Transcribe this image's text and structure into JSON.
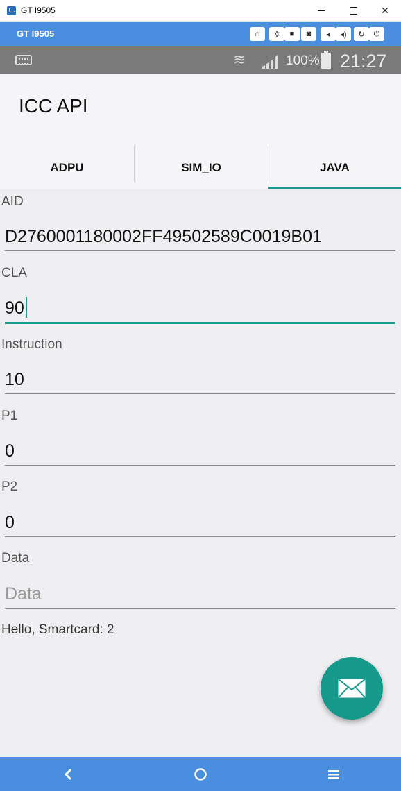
{
  "window": {
    "title": "GT I9505",
    "close_glyph": "✕"
  },
  "emulator": {
    "device_label": "GT I9505",
    "buttons": [
      {
        "icon": "headphones-icon",
        "glyph": "∩"
      },
      {
        "icon": "gear-icon",
        "glyph": "✲"
      },
      {
        "icon": "video-icon",
        "glyph": "■"
      },
      {
        "icon": "camera-icon",
        "glyph": "◙"
      },
      {
        "icon": "volume-down-icon",
        "glyph": "◂"
      },
      {
        "icon": "volume-up-icon",
        "glyph": "◂)"
      },
      {
        "icon": "rotate-icon",
        "glyph": "↻"
      },
      {
        "icon": "power-icon",
        "glyph": "⏻"
      }
    ]
  },
  "status": {
    "battery": "100%",
    "time": "21:27",
    "wifi_glyph": "≋"
  },
  "app": {
    "title": "ICC API"
  },
  "tabs": [
    {
      "label": "ADPU",
      "selected": false
    },
    {
      "label": "SIM_IO",
      "selected": false
    },
    {
      "label": "JAVA",
      "selected": true
    }
  ],
  "accent_color": "#1a9a8a",
  "fields": {
    "aid": {
      "label": "AID",
      "value": "D2760001180002FF49502589C0019B01"
    },
    "cla": {
      "label": "CLA",
      "value": "90"
    },
    "instruction": {
      "label": "Instruction",
      "value": "10"
    },
    "p1": {
      "label": "P1",
      "value": "0"
    },
    "p2": {
      "label": "P2",
      "value": "0"
    },
    "data": {
      "label": "Data",
      "value": "",
      "placeholder": "Data"
    }
  },
  "result_text": "Hello, Smartcard: 2",
  "fab": {
    "icon": "email-icon"
  },
  "nav": {
    "back_icon": "back-icon",
    "home_icon": "home-icon",
    "menu_icon": "menu-icon"
  }
}
